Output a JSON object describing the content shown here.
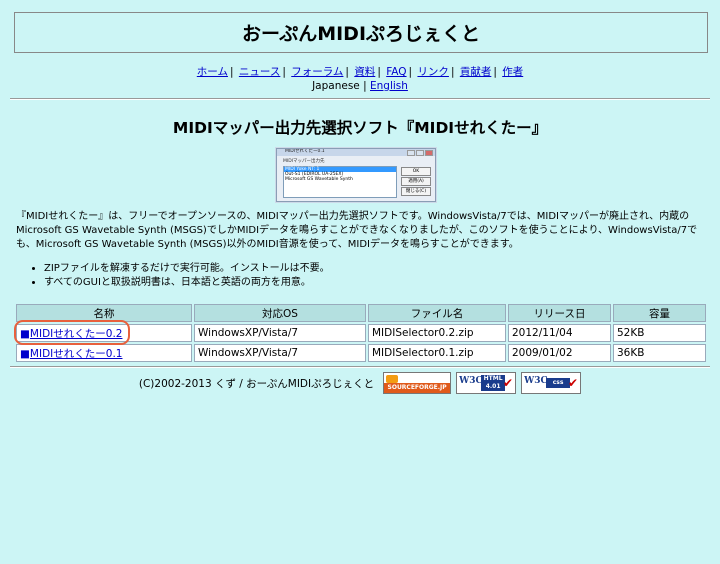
{
  "site": {
    "title": "おーぷんMIDIぷろじぇくと"
  },
  "nav": {
    "items": [
      "ホーム",
      "ニュース",
      "フォーラム",
      "資料",
      "FAQ",
      "リンク",
      "貢献者",
      "作者"
    ],
    "languages": [
      "Japanese",
      "English"
    ]
  },
  "page": {
    "heading": "MIDIマッパー出力先選択ソフト『MIDIせれくたー』",
    "description": "『MIDIせれくたー』は、フリーでオープンソースの、MIDIマッパー出力先選択ソフトです。WindowsVista/7では、MIDIマッパーが廃止され、内蔵のMicrosoft GS Wavetable Synth (MSGS)でしかMIDIデータを鳴らすことができなくなりましたが、このソフトを使うことにより、WindowsVista/7でも、Microsoft GS Wavetable Synth (MSGS)以外のMIDI音源を使って、MIDIデータを鳴らすことができます。",
    "bullets": [
      "ZIPファイルを解凍するだけで実行可能。インストールは不要。",
      "すべてのGUIと取扱説明書は、日本語と英語の両方を用意。"
    ]
  },
  "screenshot": {
    "window_title": "MIDIせれくたー0.1",
    "label": "MIDIマッパー出力先",
    "list": [
      "MIDI Yoke NT: 1",
      "Out-S1 (EDIROL UA-25EX)",
      "Microsoft GS Wavetable Synth"
    ],
    "buttons": [
      "OK",
      "適用(A)",
      "閉じる(C)"
    ]
  },
  "table": {
    "headers": [
      "名称",
      "対応OS",
      "ファイル名",
      "リリース日",
      "容量"
    ],
    "rows": [
      {
        "name": "MIDIせれくたー0.2",
        "os": "WindowsXP/Vista/7",
        "file": "MIDISelector0.2.zip",
        "date": "2012/11/04",
        "size": "52KB"
      },
      {
        "name": "MIDIせれくたー0.1",
        "os": "WindowsXP/Vista/7",
        "file": "MIDISelector0.1.zip",
        "date": "2009/01/02",
        "size": "36KB"
      }
    ],
    "bullet_glyph": "■"
  },
  "footer": {
    "copyright": "(C)2002-2013 くず / おーぷんMIDIぷろじぇくと",
    "badges": {
      "sourceforge": "SOURCEFORGE.JP",
      "w3c_html": {
        "mark": "W3C",
        "tag": "HTML 4.01"
      },
      "w3c_css": {
        "mark": "W3C",
        "tag": "css"
      }
    }
  },
  "colors": {
    "background": "#ccf5f5",
    "link": "#0000cc",
    "table_header": "#b4e0e0",
    "highlight": "#e8603c"
  }
}
